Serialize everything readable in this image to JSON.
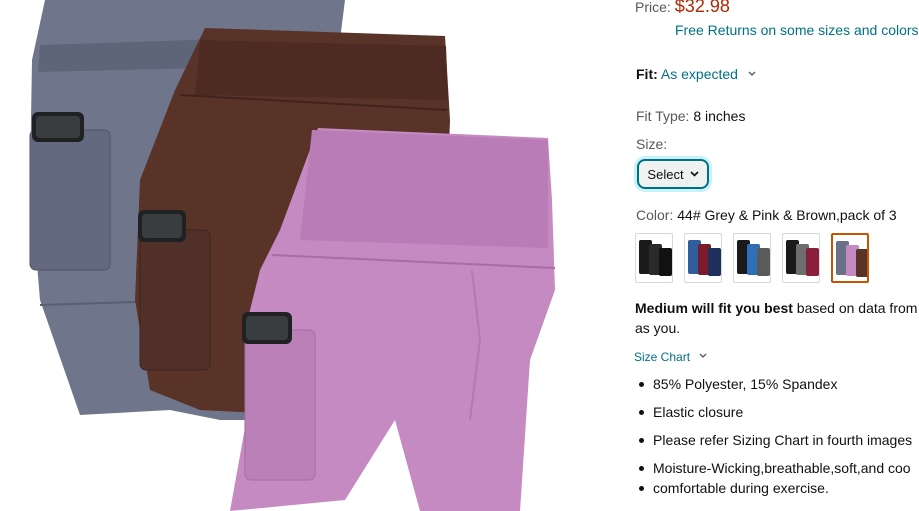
{
  "price": {
    "label": "Price:",
    "value": "$32.98",
    "returns": "Free Returns on some sizes and colors"
  },
  "fit": {
    "label": "Fit:",
    "value": "As expected"
  },
  "fit_type": {
    "label": "Fit Type:",
    "value": "8 inches"
  },
  "size": {
    "label": "Size:",
    "select_label": "Select"
  },
  "color": {
    "label": "Color:",
    "value": "44# Grey & Pink & Brown,pack of 3",
    "swatches": [
      {
        "colors": [
          "#1a1a1a",
          "#2a2a2a",
          "#111111"
        ],
        "selected": false
      },
      {
        "colors": [
          "#2f5da0",
          "#7a1c2e",
          "#1d2f5a"
        ],
        "selected": false
      },
      {
        "colors": [
          "#1a1a1a",
          "#2e6fb8",
          "#5a5a5a"
        ],
        "selected": false
      },
      {
        "colors": [
          "#1a1a1a",
          "#6e6e6e",
          "#8a1f3b"
        ],
        "selected": false
      },
      {
        "colors": [
          "#6a7085",
          "#c58ac2",
          "#5a3328"
        ],
        "selected": true
      }
    ]
  },
  "fit_note": {
    "bold": "Medium will fit you best",
    "rest": " based on data from",
    "line2": "as you."
  },
  "size_chart": {
    "label": "Size Chart"
  },
  "bullets": [
    "85% Polyester, 15% Spandex",
    "Elastic closure",
    "Please refer Sizing Chart in fourth images",
    "Moisture-Wicking,breathable,soft,and coo",
    "comfortable during exercise."
  ],
  "product_colors": {
    "grey": "#6a7085",
    "brown": "#5a3328",
    "pink": "#c58ac2"
  }
}
